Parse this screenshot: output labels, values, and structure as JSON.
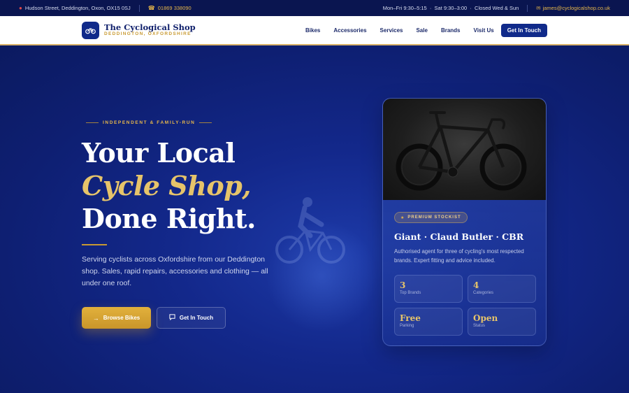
{
  "topbar": {
    "address": "Hudson Street, Deddington, Oxon, OX15 0SJ",
    "phone": "01869 338090",
    "hours": "Mon–Fri 9:30–5:15  ·  Sat 9:30–3:00  ·  Closed Wed & Sun",
    "email": "james@cyclogicalshop.co.uk"
  },
  "header": {
    "brand_name": "The Cyclogical Shop",
    "brand_location": "DEDDINGTON, OXFORDSHIRE",
    "nav": [
      "Bikes",
      "Accessories",
      "Services",
      "Sale",
      "Brands",
      "Visit Us"
    ],
    "cta": "Get In Touch"
  },
  "hero": {
    "eyebrow": "INDEPENDENT & FAMILY-RUN",
    "headline_1": "Your Local",
    "headline_2": "Cycle Shop,",
    "headline_3": "Done Right.",
    "lead": "Serving cyclists across Oxfordshire from our Deddington shop. Sales, rapid repairs, accessories and clothing — all under one roof.",
    "btn_primary": "Browse Bikes",
    "btn_secondary": "Get In Touch"
  },
  "card": {
    "badge": "PREMIUM STOCKIST",
    "title": "Giant · Claud Butler · CBR",
    "desc": "Authorised agent for three of cycling's most respected brands. Expert fitting and advice included.",
    "stats": [
      {
        "value": "3",
        "label": "Top Brands"
      },
      {
        "value": "4",
        "label": "Categories"
      },
      {
        "value": "Free",
        "label": "Parking"
      },
      {
        "value": "Open",
        "label": "Status"
      }
    ]
  },
  "colors": {
    "navy": "#0f1f6b",
    "gold": "#e8b84a",
    "button_blue": "#102a8a"
  },
  "icons": [
    "map-pin-icon",
    "phone-icon",
    "mail-icon",
    "bicycle-logo-icon",
    "arrow-right-icon",
    "chat-icon",
    "star-icon"
  ]
}
